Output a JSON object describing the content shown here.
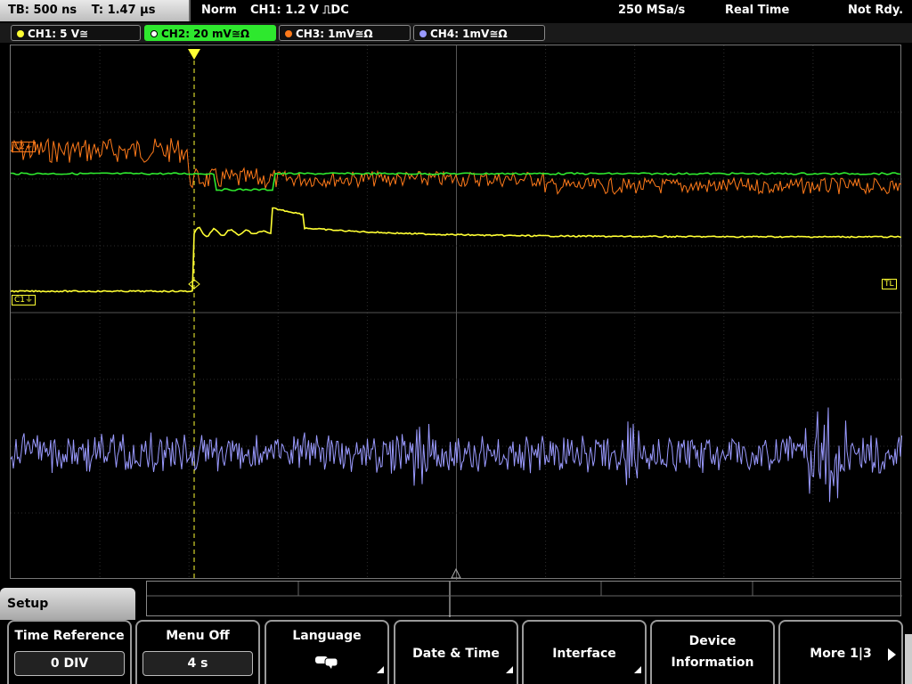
{
  "topbar": {
    "timebase": "TB: 500 ns",
    "trigger_time": "T: 1.47 µs",
    "mode": "Norm",
    "trigger": "CH1: 1.2 V ⎍DC",
    "sample_rate": "250 MSa/s",
    "acq_mode": "Real Time",
    "status": "Not Rdy."
  },
  "channels": [
    {
      "label": "CH1: 5 V≅",
      "color": "#ffff33"
    },
    {
      "label": "CH2: 20 mV≅Ω",
      "color": "#2ee82e"
    },
    {
      "label": "CH3: 1mV≅Ω",
      "color": "#ff7a1a"
    },
    {
      "label": "CH4: 1mV≅Ω",
      "color": "#9a9aff"
    }
  ],
  "markers": {
    "c1": "C1⏚",
    "c2": "C2⏚",
    "tl": "TL"
  },
  "menu": {
    "title": "Setup",
    "softkeys": [
      {
        "title": "Time Reference",
        "value": "0 DIV"
      },
      {
        "title": "Menu Off",
        "value": "4 s"
      },
      {
        "title": "Language",
        "icon": "speech-bubbles-icon"
      },
      {
        "title": "Date & Time"
      },
      {
        "title": "Interface"
      },
      {
        "line1": "Device",
        "line2": "Information"
      },
      {
        "title": "More 1|3"
      }
    ]
  }
}
